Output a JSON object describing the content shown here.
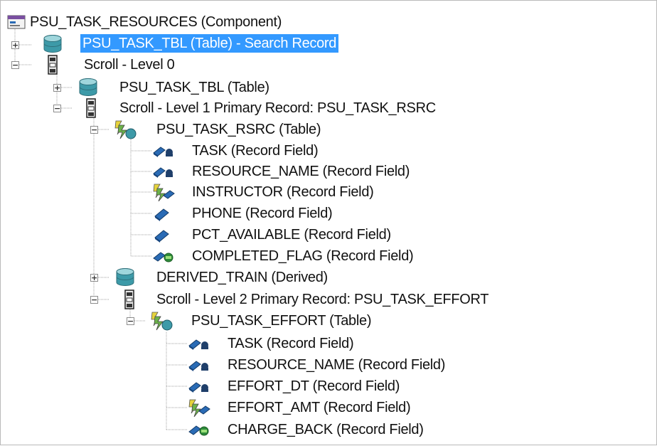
{
  "tree": {
    "root": {
      "label": "PSU_TASK_RESOURCES (Component)",
      "icon": "component-icon"
    },
    "search_record": {
      "label": "PSU_TASK_TBL (Table) - Search Record",
      "icon": "table-icon",
      "selected": true
    },
    "scroll0": {
      "label": "Scroll - Level 0",
      "icon": "scroll-icon"
    },
    "task_tbl": {
      "label": "PSU_TASK_TBL (Table)",
      "icon": "table-icon"
    },
    "scroll1": {
      "label": "Scroll - Level 1  Primary Record: PSU_TASK_RSRC",
      "icon": "scroll-icon"
    },
    "rsrc_table": {
      "label": "PSU_TASK_RSRC (Table)",
      "icon": "record-table-icon"
    },
    "rsrc_fields": [
      {
        "label": "TASK (Record Field)",
        "icon": "key-field-icon"
      },
      {
        "label": "RESOURCE_NAME (Record Field)",
        "icon": "key-field-icon"
      },
      {
        "label": "INSTRUCTOR (Record Field)",
        "icon": "prompt-field-icon"
      },
      {
        "label": "PHONE (Record Field)",
        "icon": "field-icon"
      },
      {
        "label": "PCT_AVAILABLE (Record Field)",
        "icon": "field-icon"
      },
      {
        "label": "COMPLETED_FLAG (Record Field)",
        "icon": "flag-field-icon"
      }
    ],
    "derived": {
      "label": "DERIVED_TRAIN (Derived)",
      "icon": "table-icon"
    },
    "scroll2": {
      "label": "Scroll - Level 2  Primary Record: PSU_TASK_EFFORT",
      "icon": "scroll-icon"
    },
    "effort_table": {
      "label": "PSU_TASK_EFFORT (Table)",
      "icon": "record-table-icon"
    },
    "effort_fields": [
      {
        "label": "TASK (Record Field)",
        "icon": "key-field-icon"
      },
      {
        "label": "RESOURCE_NAME (Record Field)",
        "icon": "key-field-icon"
      },
      {
        "label": "EFFORT_DT (Record Field)",
        "icon": "key-field-icon"
      },
      {
        "label": "EFFORT_AMT (Record Field)",
        "icon": "prompt-field-icon"
      },
      {
        "label": "CHARGE_BACK (Record Field)",
        "icon": "flag-field-icon"
      }
    ]
  },
  "colors": {
    "selection": "#3399ff",
    "tree_line": "#a0a0a0",
    "icon_blue": "#2a6bb5",
    "icon_teal": "#3d9aa8"
  }
}
